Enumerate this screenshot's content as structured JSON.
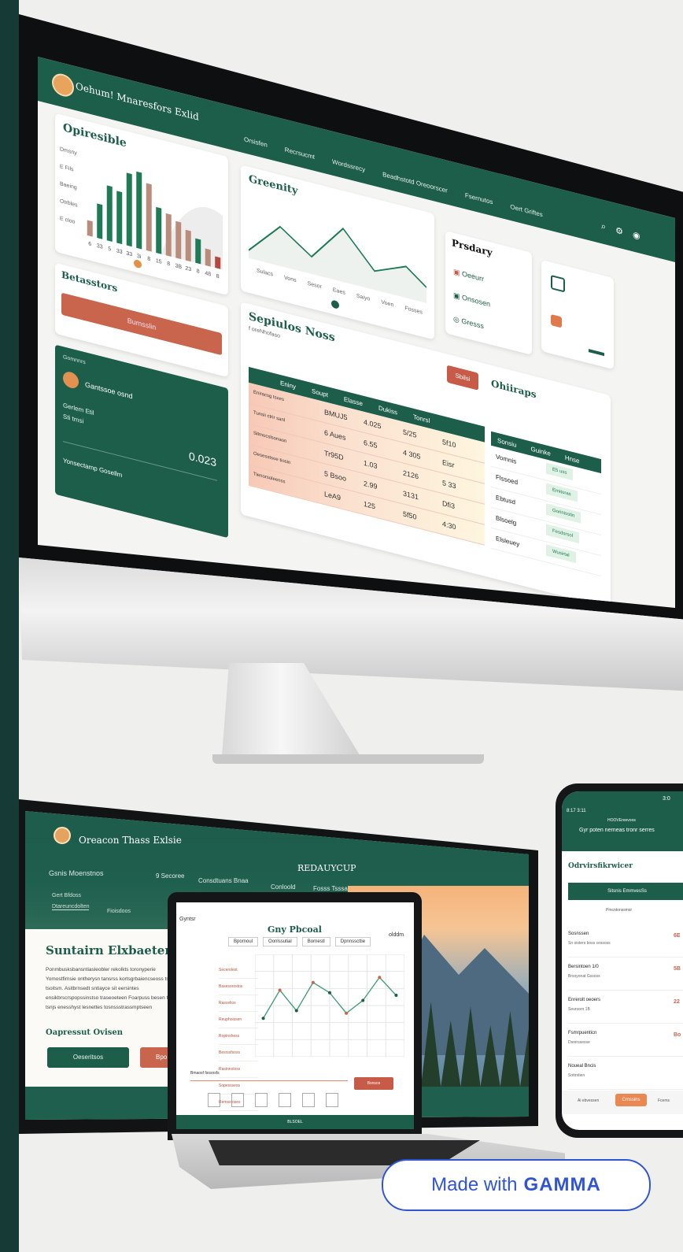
{
  "monitor": {
    "app_title": "Oehum! Mnaresfors Exlid",
    "nav": [
      "Orsisfen",
      "Recrsucmt",
      "Wordssrecy",
      "Beadhstotd Oreoorscer",
      "Fsernutos",
      "Oert Griftes"
    ],
    "chart_card_title": "Opiresible",
    "chart_y_labels": [
      "Dmsny",
      "E Fils",
      "Baeing",
      "Otrbles",
      "E cloo"
    ],
    "line_card_title": "Greenity",
    "line_x_labels": [
      "Sulacs",
      "Vons",
      "Sesor",
      "Eaes",
      "Saiyo",
      "Voen",
      "Fosses"
    ],
    "right_card_title": "Prsdary",
    "right_items": [
      "Oeeurr",
      "Onsosen",
      "Gresss"
    ],
    "breakdown_title": "Betasstors",
    "breakdown_button": "Bumsslin",
    "account_section_label": "Gomnnrs",
    "account_name": "Gantssoe osnd",
    "account_sub": "Gerlem Etil",
    "account_sub2": "Sti tmsi",
    "account_value": "0.023",
    "account_footer": "Yonsectamp Gosellm",
    "table_title": "Sepiulos Noss",
    "table_subtitle": "f oreNhofaso",
    "table_button": "Sbilsi",
    "side_title": "Ohiiraps",
    "table_cols": [
      "Eniny",
      "Soupt",
      "Elasse",
      "Dukiss",
      "Tonrsl"
    ],
    "table_rows": [
      {
        "label": "Eniracsg tsxes",
        "a": "BMUJ5",
        "b": "4.025",
        "c": "5/25",
        "d": "5f10"
      },
      {
        "label": "Tunsii ctrir sanl",
        "a": "6 Aues",
        "b": "6.55",
        "c": "4 305",
        "d": "Eisr"
      },
      {
        "label": "Sitmocslsonaon",
        "a": "Tr95D",
        "b": "1.03",
        "c": "2126",
        "d": "5 33"
      },
      {
        "label": "Oesesstsoe tiosin",
        "a": "5 Bsoo",
        "b": "2.99",
        "c": "3131",
        "d": "Dfi3"
      },
      {
        "label": "Tienorsoleenss",
        "a": "LeA9",
        "b": "125",
        "c": "5f50",
        "d": "4:30"
      }
    ],
    "right_cols": [
      "Sonsiu",
      "Guinke",
      "Hnse"
    ],
    "right_rows": [
      "Vomnis",
      "Flssoed",
      "Ebtusd",
      "Blsoelg",
      "Elsleuey"
    ],
    "right_status": [
      "E5 uss",
      "Emitoras",
      "Gorinisstin",
      "Fesdsrsol",
      "Wusirtal"
    ]
  },
  "chart_data": {
    "type": "bar",
    "categories": [
      "6",
      "33",
      "5",
      "33",
      "33",
      "3i",
      "8",
      "15",
      "8",
      "3B",
      "23",
      "8",
      "48",
      "8"
    ],
    "series": [
      {
        "name": "",
        "values": [
          20,
          45,
          72,
          68,
          95,
          100,
          88,
          60,
          55,
          48,
          40,
          32,
          22,
          15
        ]
      }
    ],
    "colors": {
      "green": "#1f7a56",
      "tan": "#b98d7c",
      "red": "#b54840"
    }
  },
  "laptop_back": {
    "brand": "Oreacon Thass Exlsie",
    "nav": [
      "Gsnis Moenstnos",
      "9 Secoree",
      "Consdtuans Bnaa",
      "Conloold",
      "Fosss Tsssa"
    ],
    "hero_label": "REDAUYCUP",
    "sub_tabs": [
      "Gert Bfdoss",
      "Dtareuncdolten",
      "Fioisdoos"
    ],
    "heading": "Suntairn Elxbaeteny",
    "body": "Ponmbusksbansntiasleobler rekolkts toronyperie Yomostfirnsie ontherysn tansrss kortsgrbaiencseoss tsw cstor tsoitsm. Asitbrnsedt sntiayce sit eersintes ensikbrscrspopssinstso traseoeteen Foarpuss besen tnsks tsnjs enesshyst lesnettes tosnssstrassmptseen",
    "cta_label": "Oapressut Ovisen",
    "btn_primary": "Oeseritsos",
    "btn_secondary": "Bpo"
  },
  "laptop": {
    "top_label": "Gyntsr",
    "title": "Gny Pbcoal",
    "title_right": "olddm",
    "tabs": [
      "Bpornoul",
      "Oonlssutial",
      "Bornestl",
      "Dpnnsscttie"
    ],
    "left_rows": [
      "Secerolest",
      "Basesorostos",
      "Rascelios",
      "Reuphoissen",
      "Ropinshess",
      "Besrssfsoss",
      "Rasinnoloss",
      "Sopesssess",
      "Remsoloses",
      "Basoloes"
    ],
    "footer_label": "Bmaosf fsosnsfs",
    "footer_button": "Bsnsos",
    "bottom_label": "BLSOEL"
  },
  "laptop_line": {
    "values": [
      30,
      52,
      36,
      58,
      50,
      34,
      44,
      62,
      48
    ]
  },
  "phone": {
    "time": "8:17 3:11",
    "clock_right": "3:0",
    "header_small": "HOOVEreevoos",
    "header_title": "Gyr poten nerneas tronr serres",
    "section_title": "Odrvirsfikrwicer",
    "button": "Sitsnis EmmvesSs",
    "subhead": "Pmcntonssmsr",
    "items": [
      {
        "title": "Sosnssen",
        "sub": "Sn oisters boss cessoss",
        "val": "6E"
      },
      {
        "title": "Bersintoen 1/0",
        "sub": "Brsoyonat Gssoss",
        "val": "5B"
      },
      {
        "title": "Enrerolt oeoers",
        "sub": "Seursorn 1B",
        "val": "22"
      },
      {
        "title": "Fsmrpuenticn",
        "sub": "Dsrerssesse",
        "val": "Bo"
      },
      {
        "title": "Noueal Bncis",
        "sub": "Sottrstien",
        "val": ""
      }
    ],
    "footer_left": "Ai ebvessen",
    "footer_button": "Cmssins",
    "footer_right": "Fcems"
  },
  "badge": {
    "made": "Made with",
    "brand": "GAMMA"
  },
  "colors": {
    "brand_green": "#1d5e4a",
    "accent_orange": "#c86a4f",
    "badge_blue": "#2f55d4"
  }
}
